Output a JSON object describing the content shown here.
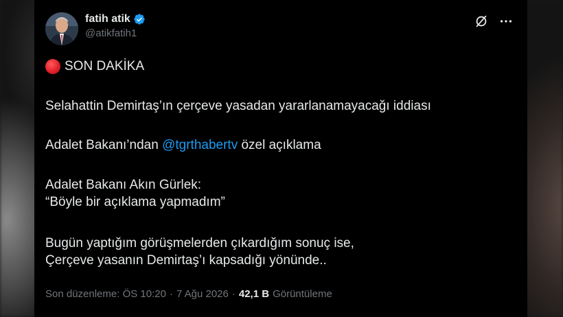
{
  "author": {
    "display_name": "fatih atik",
    "handle": "@atikfatih1",
    "verified": true
  },
  "header_actions": {
    "grok_icon": "slashed-circle-icon",
    "more_icon": "more-icon"
  },
  "tweet": {
    "breaking_label": "SON DAKİKA",
    "line_1": "Selahattin Demirtaş’ın çerçeve yasadan yararlanamayacağı iddiası",
    "line_2_prefix": "Adalet Bakanı’ndan ",
    "line_2_mention": "@tgrthabertv",
    "line_2_suffix": " özel açıklama",
    "line_3a": "Adalet Bakanı Akın Gürlek:",
    "line_3b": "“Böyle bir açıklama yapmadım”",
    "line_4a": "Bugün yaptığım görüşmelerden çıkardığım sonuç ise,",
    "line_4b": "Çerçeve yasanın Demirtaş’ı kapsadığı yönünde.."
  },
  "footer": {
    "edited_label": "Son düzenleme: ÖS 10:20",
    "separator_1": "·",
    "date": "7 Ağu 2026",
    "separator_2": "·",
    "views_count": "42,1 B",
    "views_label": "Görüntüleme"
  },
  "colors": {
    "background": "#000000",
    "text": "#e7e9ea",
    "muted": "#71767b",
    "accent": "#1d9bf0",
    "breaking_dot": "#e0202a"
  }
}
